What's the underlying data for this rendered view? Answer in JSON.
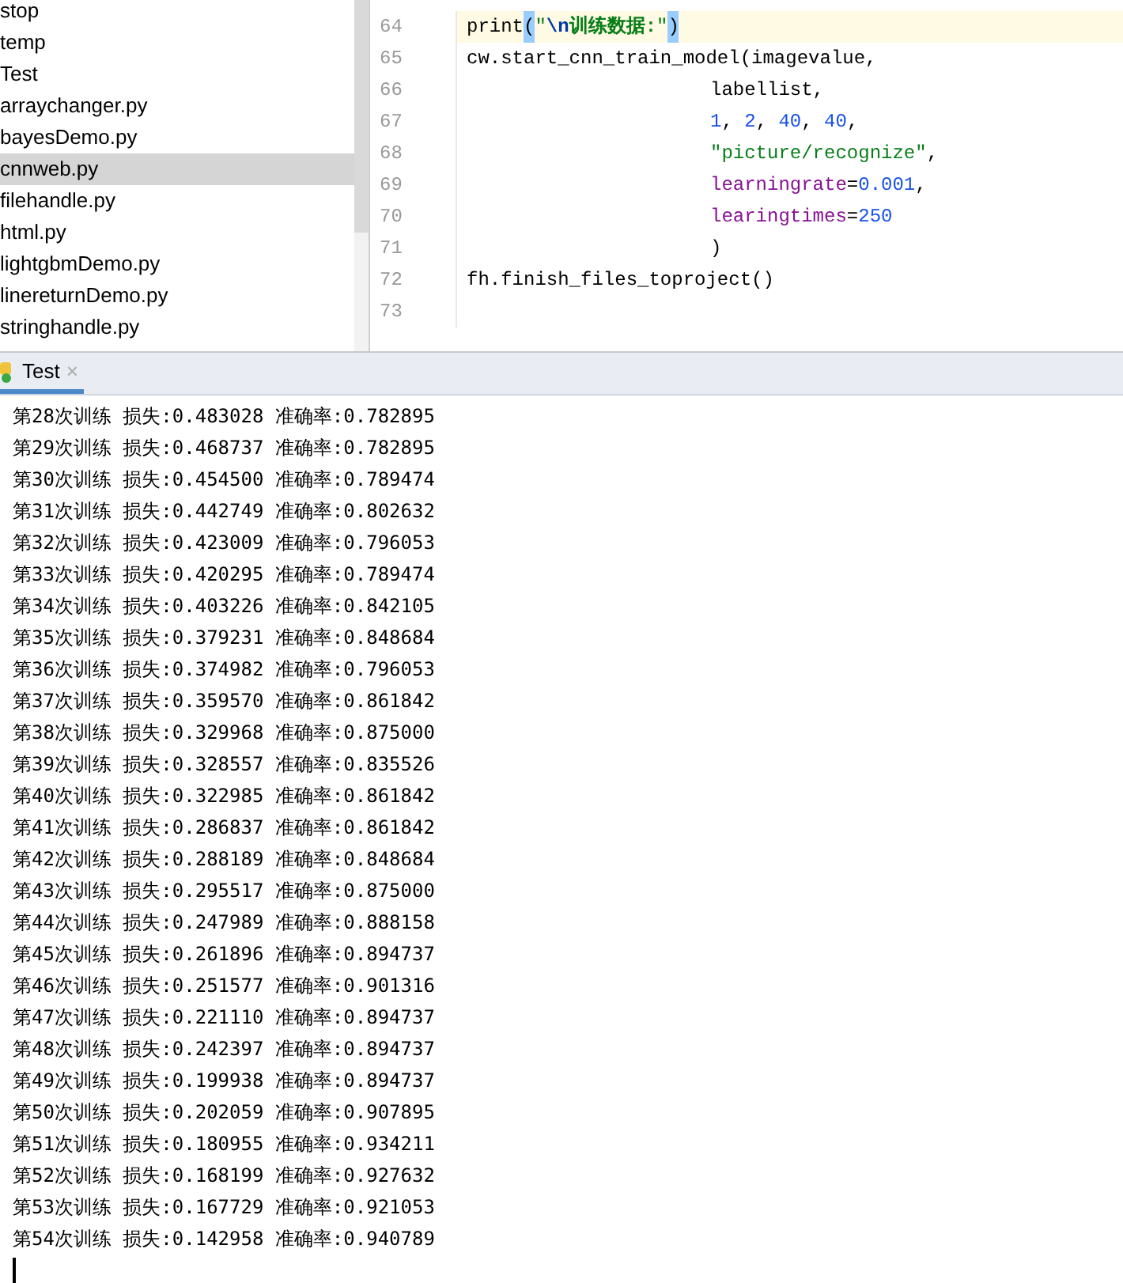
{
  "project_tree": {
    "items": [
      {
        "label": "stop",
        "selected": false
      },
      {
        "label": "temp",
        "selected": false
      },
      {
        "label": "Test",
        "selected": false
      },
      {
        "label": "arraychanger.py",
        "selected": false
      },
      {
        "label": "bayesDemo.py",
        "selected": false
      },
      {
        "label": "cnnweb.py",
        "selected": true
      },
      {
        "label": "filehandle.py",
        "selected": false
      },
      {
        "label": "html.py",
        "selected": false
      },
      {
        "label": "lightgbmDemo.py",
        "selected": false
      },
      {
        "label": "linereturnDemo.py",
        "selected": false
      },
      {
        "label": "stringhandle.py",
        "selected": false
      }
    ]
  },
  "editor": {
    "lines": [
      {
        "number": "64",
        "current": true,
        "indent": false,
        "tokens": [
          {
            "text": "print",
            "kind": "plain"
          },
          {
            "text": "(",
            "kind": "brace"
          },
          {
            "text": "\"",
            "kind": "string"
          },
          {
            "text": "\\n",
            "kind": "escape"
          },
          {
            "text": "训练数据:",
            "kind": "string-bold"
          },
          {
            "text": "\"",
            "kind": "string"
          },
          {
            "text": ")",
            "kind": "brace"
          }
        ]
      },
      {
        "number": "65",
        "current": false,
        "indent": false,
        "tokens": [
          {
            "text": "cw.start_cnn_train_model(imagevalue,",
            "kind": "plain"
          }
        ]
      },
      {
        "number": "66",
        "current": false,
        "indent": true,
        "tokens": [
          {
            "text": "labellist,",
            "kind": "plain"
          }
        ]
      },
      {
        "number": "67",
        "current": false,
        "indent": true,
        "tokens": [
          {
            "text": "1",
            "kind": "number"
          },
          {
            "text": ", ",
            "kind": "plain"
          },
          {
            "text": "2",
            "kind": "number"
          },
          {
            "text": ", ",
            "kind": "plain"
          },
          {
            "text": "40",
            "kind": "number"
          },
          {
            "text": ", ",
            "kind": "plain"
          },
          {
            "text": "40",
            "kind": "number"
          },
          {
            "text": ",",
            "kind": "plain"
          }
        ]
      },
      {
        "number": "68",
        "current": false,
        "indent": true,
        "tokens": [
          {
            "text": "\"picture/recognize\"",
            "kind": "string"
          },
          {
            "text": ",",
            "kind": "plain"
          }
        ]
      },
      {
        "number": "69",
        "current": false,
        "indent": true,
        "tokens": [
          {
            "text": "learningrate",
            "kind": "keyword-arg"
          },
          {
            "text": "=",
            "kind": "plain"
          },
          {
            "text": "0.001",
            "kind": "number"
          },
          {
            "text": ",",
            "kind": "plain"
          }
        ]
      },
      {
        "number": "70",
        "current": false,
        "indent": true,
        "tokens": [
          {
            "text": "learingtimes",
            "kind": "keyword-arg"
          },
          {
            "text": "=",
            "kind": "plain"
          },
          {
            "text": "250",
            "kind": "number"
          }
        ]
      },
      {
        "number": "71",
        "current": false,
        "indent": true,
        "tokens": [
          {
            "text": ")",
            "kind": "plain"
          }
        ]
      },
      {
        "number": "72",
        "current": false,
        "indent": false,
        "tokens": [
          {
            "text": "fh.finish_files_toproject()",
            "kind": "plain"
          }
        ]
      },
      {
        "number": "73",
        "current": false,
        "indent": false
      }
    ]
  },
  "run_panel": {
    "tabs": [
      {
        "label": "Test",
        "selected": true,
        "close": "×"
      }
    ],
    "output": [
      "第28次训练 损失:0.483028 准确率:0.782895",
      "第29次训练 损失:0.468737 准确率:0.782895",
      "第30次训练 损失:0.454500 准确率:0.789474",
      "第31次训练 损失:0.442749 准确率:0.802632",
      "第32次训练 损失:0.423009 准确率:0.796053",
      "第33次训练 损失:0.420295 准确率:0.789474",
      "第34次训练 损失:0.403226 准确率:0.842105",
      "第35次训练 损失:0.379231 准确率:0.848684",
      "第36次训练 损失:0.374982 准确率:0.796053",
      "第37次训练 损失:0.359570 准确率:0.861842",
      "第38次训练 损失:0.329968 准确率:0.875000",
      "第39次训练 损失:0.328557 准确率:0.835526",
      "第40次训练 损失:0.322985 准确率:0.861842",
      "第41次训练 损失:0.286837 准确率:0.861842",
      "第42次训练 损失:0.288189 准确率:0.848684",
      "第43次训练 损失:0.295517 准确率:0.875000",
      "第44次训练 损失:0.247989 准确率:0.888158",
      "第45次训练 损失:0.261896 准确率:0.894737",
      "第46次训练 损失:0.251577 准确率:0.901316",
      "第47次训练 损失:0.221110 准确率:0.894737",
      "第48次训练 损失:0.242397 准确率:0.894737",
      "第49次训练 损失:0.199938 准确率:0.894737",
      "第50次训练 损失:0.202059 准确率:0.907895",
      "第51次训练 损失:0.180955 准确率:0.934211",
      "第52次训练 损失:0.168199 准确率:0.927632",
      "第53次训练 损失:0.167729 准确率:0.921053",
      "第54次训练 损失:0.142958 准确率:0.940789"
    ]
  }
}
